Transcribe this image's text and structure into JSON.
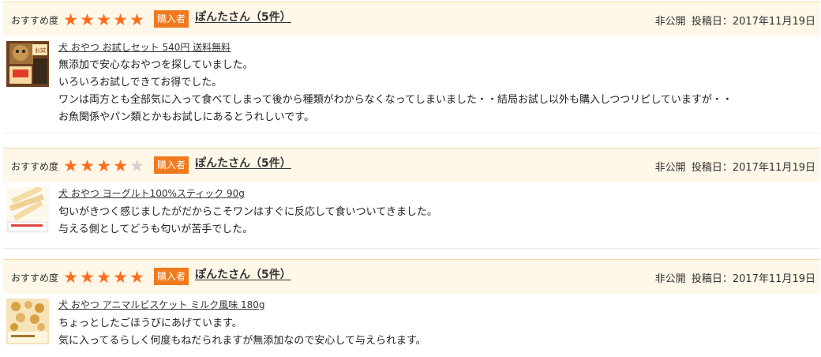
{
  "reviews": [
    {
      "recommend_label": "おすすめ度",
      "rating": 5,
      "max_rating": 5,
      "buyer_badge": "購入者",
      "user": "ぽんたさん（5件）",
      "visibility": "非公開",
      "posted": "投稿日：2017年11月19日",
      "product_link": "犬 おやつ お試しセット 540円 送料無料",
      "thumb_text": "お試し 540円",
      "lines": [
        "無添加で安心なおやつを探していました。",
        "いろいろお試しできてお得でした。",
        "ワンは両方とも全部気に入って食べてしまって後から種類がわからなくなってしまいました・・結局お試し以外も購入しつつリピしていますが・・",
        "お魚関係やパン類とかもお試しにあるとうれしいです。"
      ]
    },
    {
      "recommend_label": "おすすめ度",
      "rating": 4,
      "max_rating": 5,
      "buyer_badge": "購入者",
      "user": "ぽんたさん（5件）",
      "visibility": "非公開",
      "posted": "投稿日：2017年11月19日",
      "product_link": "犬 おやつ ヨーグルト100%スティック 90g",
      "lines": [
        "匂いがきつく感じましたがだからこそワンはすぐに反応して食いついてきました。",
        "与える側としてどうも匂いが苦手でした。"
      ]
    },
    {
      "recommend_label": "おすすめ度",
      "rating": 5,
      "max_rating": 5,
      "buyer_badge": "購入者",
      "user": "ぽんたさん（5件）",
      "visibility": "非公開",
      "posted": "投稿日：2017年11月19日",
      "product_link": "犬 おやつ アニマルビスケット ミルク風味 180g",
      "lines": [
        "ちょっとしたごほうびにあげています。",
        "気に入ってるらしく何度もねだられますが無添加なので安心して与えられます。"
      ]
    }
  ],
  "colors": {
    "star_on": "#ff6d1c",
    "star_off": "#d3d3d3",
    "badge_bg": "#f07a1d",
    "header_bg": "#fff7e8"
  }
}
